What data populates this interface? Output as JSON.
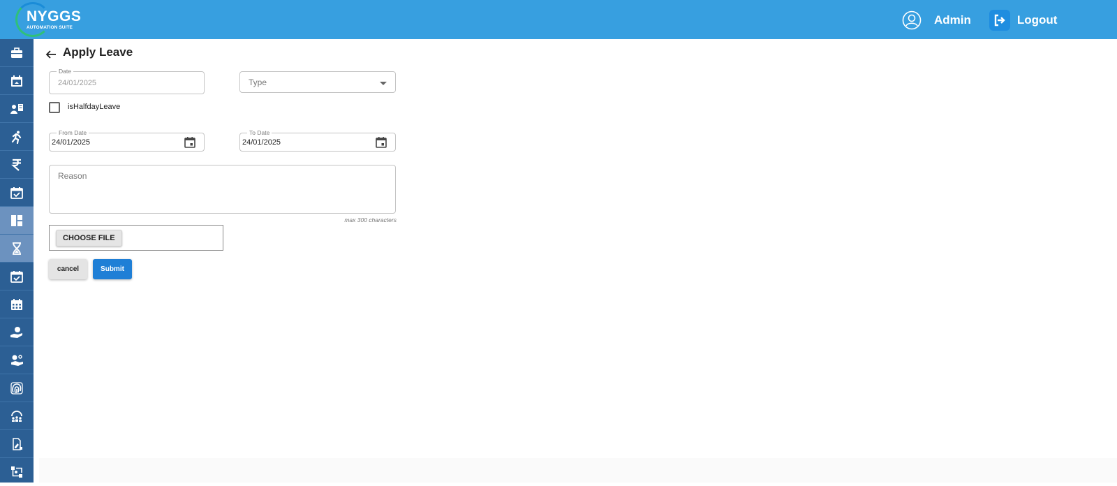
{
  "brand": {
    "name": "NYGGS",
    "tagline": "AUTOMATION SUITE"
  },
  "header": {
    "user_label": "Admin",
    "logout_label": "Logout"
  },
  "sidebar": {
    "items": [
      {
        "icon": "briefcase-icon"
      },
      {
        "icon": "calendar-icon"
      },
      {
        "icon": "id-card-icon"
      },
      {
        "icon": "run-icon"
      },
      {
        "icon": "rupee-icon"
      },
      {
        "icon": "calendar-check-icon"
      },
      {
        "icon": "dashboard-icon"
      },
      {
        "icon": "hourglass-icon"
      },
      {
        "icon": "calendar-check-icon"
      },
      {
        "icon": "calendar-grid-icon"
      },
      {
        "icon": "hand-coin-icon"
      },
      {
        "icon": "hand-money-icon"
      },
      {
        "icon": "fingerprint-icon"
      },
      {
        "icon": "team-icon"
      },
      {
        "icon": "document-sign-icon"
      },
      {
        "icon": "workflow-icon"
      }
    ],
    "active_index": [
      6,
      7
    ]
  },
  "page": {
    "title": "Apply Leave"
  },
  "form": {
    "date": {
      "label": "Date",
      "value": "24/01/2025"
    },
    "type": {
      "placeholder": "Type"
    },
    "half_day": {
      "label": "isHalfdayLeave",
      "checked": false
    },
    "from_date": {
      "label": "From Date",
      "value": "24/01/2025"
    },
    "to_date": {
      "label": "To Date",
      "value": "24/01/2025"
    },
    "reason": {
      "placeholder": "Reason",
      "hint": "max 300 characters"
    },
    "file": {
      "button_label": "CHOOSE FILE"
    },
    "cancel_label": "cancel",
    "submit_label": "Submit"
  },
  "colors": {
    "topbar": "#379fe0",
    "sidebar": "#2c5f94",
    "sidebar_active": "#6c92bf",
    "primary": "#1f7fd6"
  }
}
